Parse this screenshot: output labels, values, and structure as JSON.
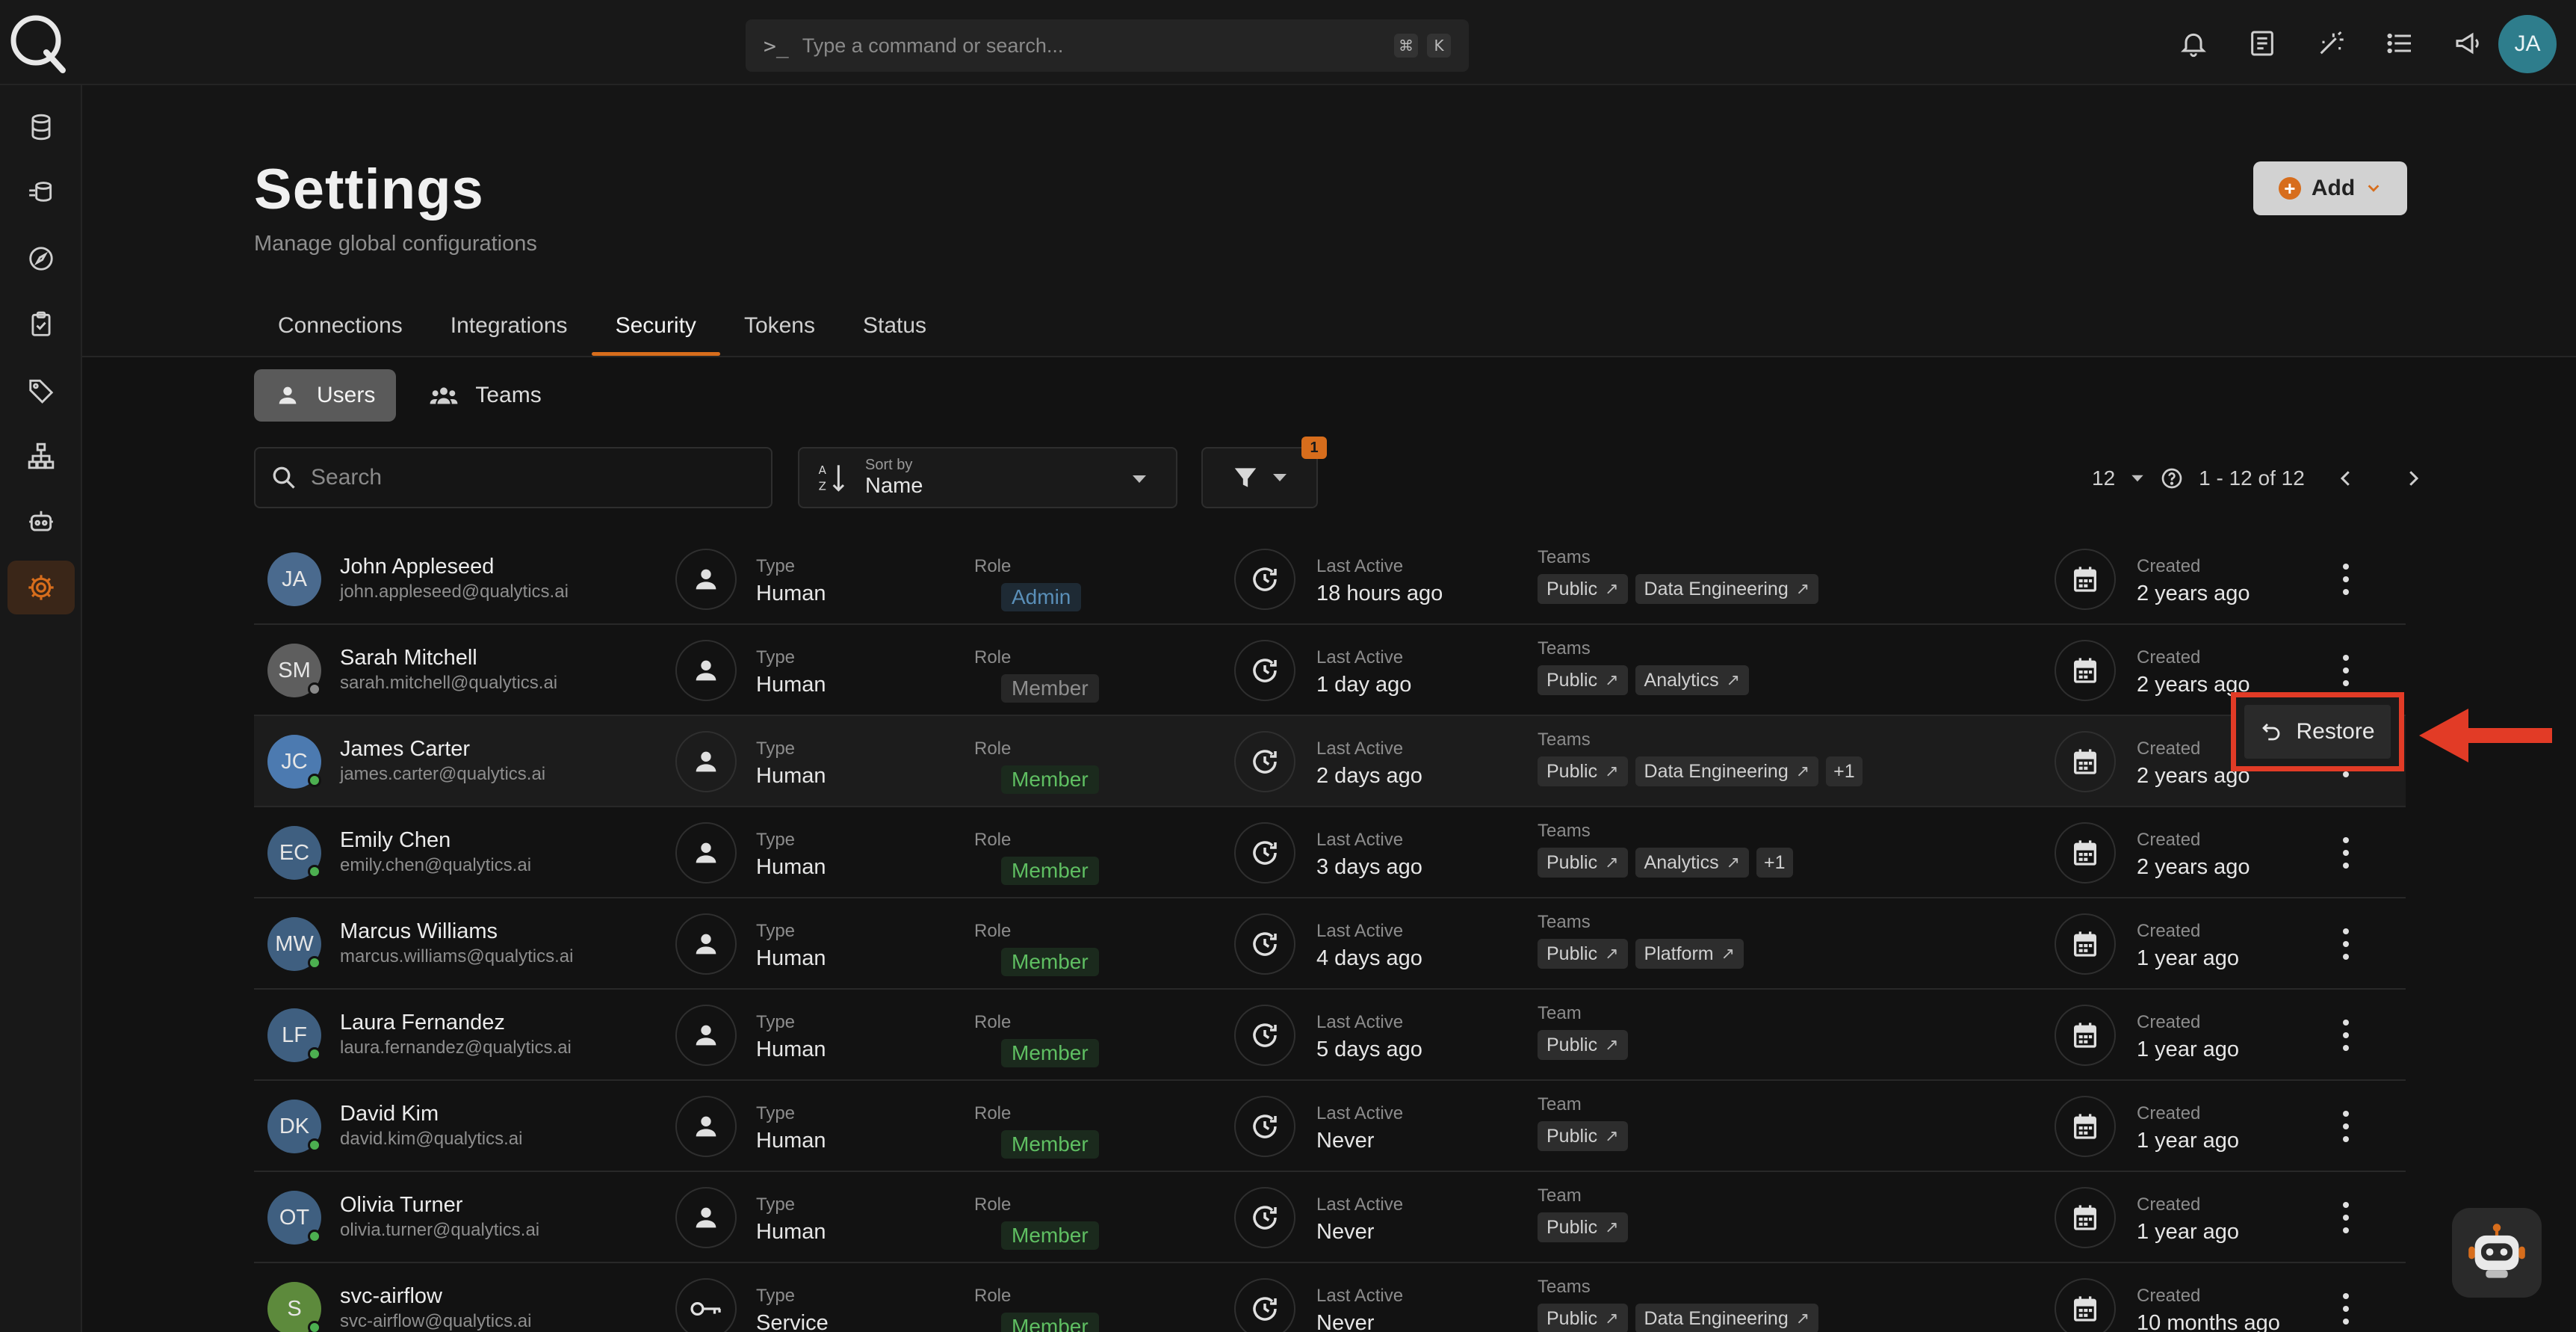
{
  "topbar": {
    "command_placeholder": "Type a command or search...",
    "kbd_cmd": "⌘",
    "kbd_k": "K",
    "icons": [
      "bell-icon",
      "notes-icon",
      "magic-wand-icon",
      "list-icon",
      "megaphone-icon"
    ],
    "avatar_initials": "JA"
  },
  "rail": {
    "items": [
      "database-icon",
      "data-stack-icon",
      "compass-icon",
      "checklist-icon",
      "tag-icon",
      "hierarchy-icon",
      "robot-icon",
      "gear-icon"
    ],
    "active": "gear-icon"
  },
  "header": {
    "title": "Settings",
    "subtitle": "Manage global configurations",
    "add_label": "Add",
    "tabs": [
      "Connections",
      "Integrations",
      "Security",
      "Tokens",
      "Status"
    ],
    "active_tab": "Security"
  },
  "subtabs": {
    "users": "Users",
    "teams": "Teams"
  },
  "toolbar": {
    "search_placeholder": "Search",
    "sort_label": "Sort by",
    "sort_value": "Name",
    "filter_count": "1"
  },
  "pager": {
    "page_size": "12",
    "range": "1 - 12 of 12"
  },
  "labels": {
    "type": "Type",
    "role": "Role",
    "last_active": "Last Active",
    "teams": "Teams",
    "team": "Team",
    "created": "Created"
  },
  "users": [
    {
      "initials": "JA",
      "name": "John Appleseed",
      "email": "john.appleseed@qualytics.ai",
      "type": "Human",
      "role": "Admin",
      "role_style": "admin",
      "last_active": "18 hours ago",
      "teams_label": "Teams",
      "teams": [
        "Public",
        "Data Engineering"
      ],
      "extra": "",
      "created": "2 years ago",
      "avatar_color": "#4a6a8e",
      "status": ""
    },
    {
      "initials": "SM",
      "name": "Sarah Mitchell",
      "email": "sarah.mitchell@qualytics.ai",
      "type": "Human",
      "role": "Member",
      "role_style": "member-gray",
      "last_active": "1 day ago",
      "teams_label": "Teams",
      "teams": [
        "Public",
        "Analytics"
      ],
      "extra": "",
      "created": "2 years ago",
      "avatar_color": "#5e5e5e",
      "status": "#8a8a8a"
    },
    {
      "initials": "JC",
      "name": "James Carter",
      "email": "james.carter@qualytics.ai",
      "type": "Human",
      "role": "Member",
      "role_style": "member-green",
      "last_active": "2 days ago",
      "teams_label": "Teams",
      "teams": [
        "Public",
        "Data Engineering"
      ],
      "extra": "+1",
      "created": "2 years ago",
      "avatar_color": "#4c7ab0",
      "status": "#4caf50"
    },
    {
      "initials": "EC",
      "name": "Emily Chen",
      "email": "emily.chen@qualytics.ai",
      "type": "Human",
      "role": "Member",
      "role_style": "member-green",
      "last_active": "3 days ago",
      "teams_label": "Teams",
      "teams": [
        "Public",
        "Analytics"
      ],
      "extra": "+1",
      "created": "2 years ago",
      "avatar_color": "#3f5f80",
      "status": "#4caf50"
    },
    {
      "initials": "MW",
      "name": "Marcus Williams",
      "email": "marcus.williams@qualytics.ai",
      "type": "Human",
      "role": "Member",
      "role_style": "member-green",
      "last_active": "4 days ago",
      "teams_label": "Teams",
      "teams": [
        "Public",
        "Platform"
      ],
      "extra": "",
      "created": "1 year ago",
      "avatar_color": "#3f5f80",
      "status": "#4caf50"
    },
    {
      "initials": "LF",
      "name": "Laura Fernandez",
      "email": "laura.fernandez@qualytics.ai",
      "type": "Human",
      "role": "Member",
      "role_style": "member-green",
      "last_active": "5 days ago",
      "teams_label": "Team",
      "teams": [
        "Public"
      ],
      "extra": "",
      "created": "1 year ago",
      "avatar_color": "#3f5f80",
      "status": "#4caf50"
    },
    {
      "initials": "DK",
      "name": "David Kim",
      "email": "david.kim@qualytics.ai",
      "type": "Human",
      "role": "Member",
      "role_style": "member-green",
      "last_active": "Never",
      "teams_label": "Team",
      "teams": [
        "Public"
      ],
      "extra": "",
      "created": "1 year ago",
      "avatar_color": "#3f5f80",
      "status": "#4caf50"
    },
    {
      "initials": "OT",
      "name": "Olivia Turner",
      "email": "olivia.turner@qualytics.ai",
      "type": "Human",
      "role": "Member",
      "role_style": "member-green",
      "last_active": "Never",
      "teams_label": "Team",
      "teams": [
        "Public"
      ],
      "extra": "",
      "created": "1 year ago",
      "avatar_color": "#3f5f80",
      "status": "#4caf50"
    },
    {
      "initials": "S",
      "name": "svc-airflow",
      "email": "svc-airflow@qualytics.ai",
      "type": "Service",
      "role": "Member",
      "role_style": "member-green",
      "last_active": "Never",
      "teams_label": "Teams",
      "teams": [
        "Public",
        "Data Engineering"
      ],
      "extra": "",
      "created": "10 months ago",
      "avatar_color": "#5d8a3c",
      "status": "#4caf50"
    }
  ],
  "restore_label": "Restore",
  "colors": {
    "accent": "#d76d1c",
    "annotation": "#e23b26",
    "success": "#4caf50"
  }
}
